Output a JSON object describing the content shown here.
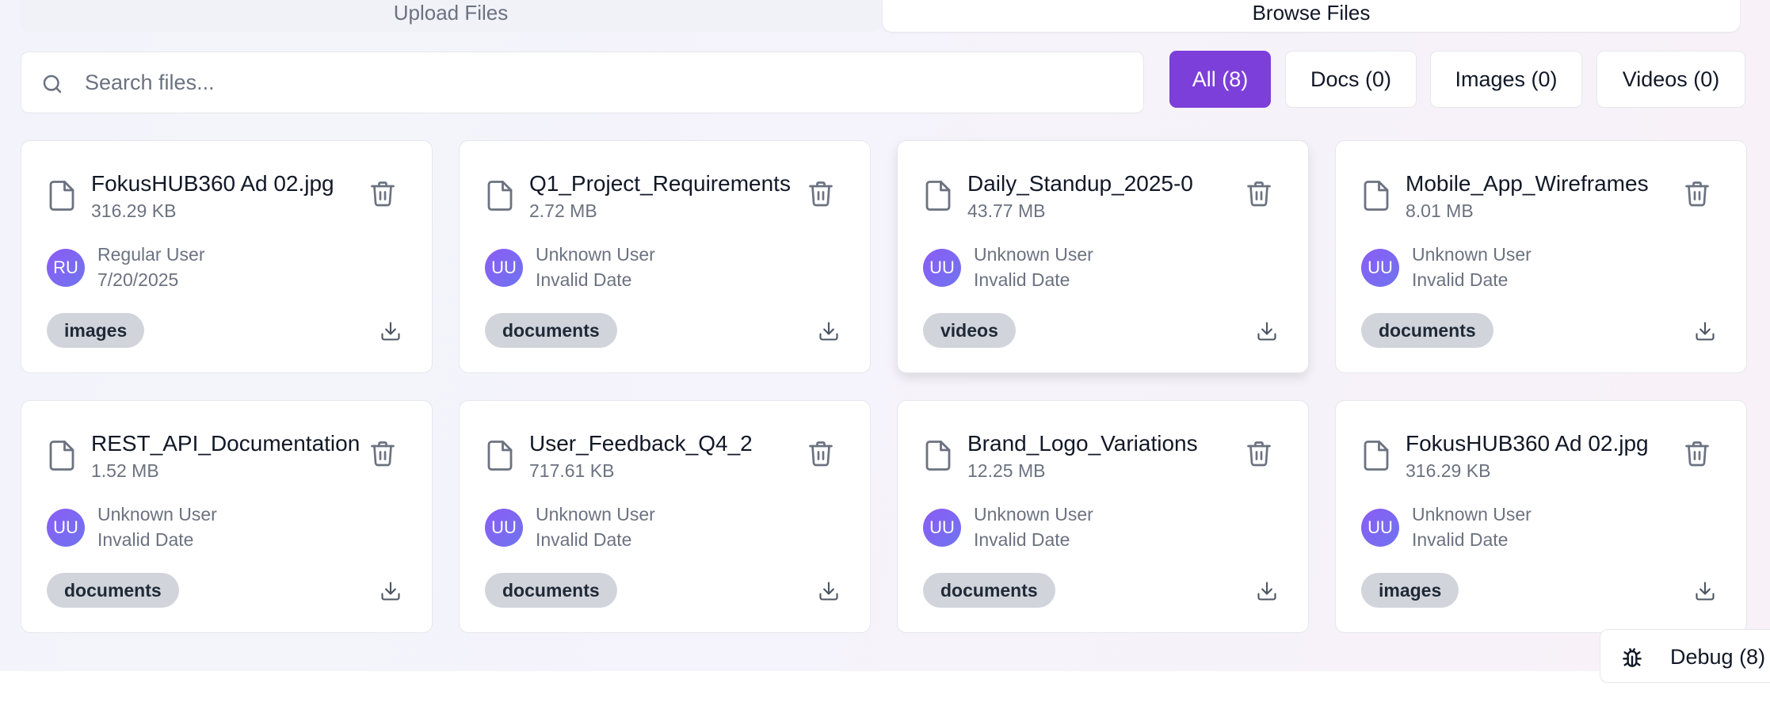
{
  "tabs": {
    "upload_label": "Upload Files",
    "browse_label": "Browse Files",
    "active": "Browse Files"
  },
  "search": {
    "placeholder": "Search files...",
    "value": ""
  },
  "filters": [
    {
      "label": "All (8)",
      "active": true
    },
    {
      "label": "Docs (0)",
      "active": false
    },
    {
      "label": "Images (0)",
      "active": false
    },
    {
      "label": "Videos (0)",
      "active": false
    }
  ],
  "files": [
    {
      "name": "FokusHUB360 Ad 02.jpg",
      "size": "316.29 KB",
      "initials": "RU",
      "uploader": "Regular User",
      "date": "7/20/2025",
      "category": "images"
    },
    {
      "name": "Q1_Project_Requirements",
      "size": "2.72 MB",
      "initials": "UU",
      "uploader": "Unknown User",
      "date": "Invalid Date",
      "category": "documents"
    },
    {
      "name": "Daily_Standup_2025-0",
      "size": "43.77 MB",
      "initials": "UU",
      "uploader": "Unknown User",
      "date": "Invalid Date",
      "category": "videos"
    },
    {
      "name": "Mobile_App_Wireframes",
      "size": "8.01 MB",
      "initials": "UU",
      "uploader": "Unknown User",
      "date": "Invalid Date",
      "category": "documents"
    },
    {
      "name": "REST_API_Documentation",
      "size": "1.52 MB",
      "initials": "UU",
      "uploader": "Unknown User",
      "date": "Invalid Date",
      "category": "documents"
    },
    {
      "name": "User_Feedback_Q4_2",
      "size": "717.61 KB",
      "initials": "UU",
      "uploader": "Unknown User",
      "date": "Invalid Date",
      "category": "documents"
    },
    {
      "name": "Brand_Logo_Variations",
      "size": "12.25 MB",
      "initials": "UU",
      "uploader": "Unknown User",
      "date": "Invalid Date",
      "category": "documents"
    },
    {
      "name": "FokusHUB360 Ad 02.jpg",
      "size": "316.29 KB",
      "initials": "UU",
      "uploader": "Unknown User",
      "date": "Invalid Date",
      "category": "images"
    }
  ],
  "debug": {
    "label": "Debug (8)"
  },
  "colors": {
    "accent": "#7c3fd9",
    "badge_bg": "#d1d5db",
    "avatar_from": "#8b5cf6",
    "avatar_to": "#6f74ee",
    "muted_text": "#6b7280"
  },
  "icons": {
    "search": "search-icon",
    "file": "file-icon",
    "delete": "trash-icon",
    "download": "download-icon",
    "debug": "bug-icon"
  }
}
